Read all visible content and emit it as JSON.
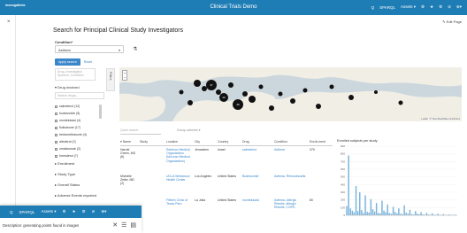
{
  "app": {
    "logo": "monogalleria",
    "title": "Clinical Trials Demo",
    "nav": [
      "Q",
      "SPARQL",
      "Assets ▾",
      "⚙",
      "★",
      "⚙",
      "⊘",
      "⊕▾"
    ]
  },
  "page": {
    "edit_label": "✎ Edit Page",
    "title": "Search for Principal Clinical Study Investigators",
    "condition_label": "Condition*",
    "condition_value": "Asthma",
    "apply": "Apply search",
    "reset": "Reset",
    "search_placeholder": "Drug, Investigator, Sponsor, Condition",
    "drug_filter": "▾  Drug involved",
    "drug_search_placeholder": "Search drugs...",
    "drugs": [
      "salmeterol (12)",
      "budesonide (5)",
      "montelukast (4)",
      "fluticasone (17)",
      "beclomethasone (4)",
      "albuterol (2)",
      "omalizumab (2)",
      "formoterol (7)"
    ],
    "enrollment": "▸  Enrollment",
    "study_type": "▸  Study Type",
    "overall_status": "▸  Overall Status",
    "adverse_events": "▸  Adverse Events reported",
    "filters_tab": "Filters"
  },
  "map": {
    "zoom_in": "+",
    "zoom_out": "−",
    "attribution": "Leaflet | © OpenStreetMap contributors"
  },
  "table": {
    "quick_search": "Quick search",
    "group_columns": "Group columns  ▾",
    "headers": [
      "▾ Name",
      "Study",
      "Location",
      "City",
      "Country",
      "Drug",
      "Condition",
      "Enroll-ment"
    ],
    "rows": [
      {
        "name": "Harold Green, MD (6)",
        "study": "",
        "location": "Rainbow Medical Organization (McLean Medical Organization)",
        "city": "Jerusalem",
        "country": "Israel",
        "drug": "salmeterol",
        "condition": "Asthma",
        "enrollment": "370"
      },
      {
        "name": "Michelle Zeller, MD (2)",
        "study": "",
        "location": "UCLA Westwood Health Center",
        "city": "Los Angeles",
        "country": "United States",
        "drug": "Budesonide",
        "condition": "Asthma, Rhinosinusitis",
        "enrollment": ""
      },
      {
        "name": "",
        "study": "",
        "location": "Fifteen Clinic of Texas Peru",
        "city": "La Jolla",
        "country": "United States",
        "drug": "montelukast",
        "condition": "Asthma, Allergic Rhinitis, Allergic Rhinitis, COPD",
        "enrollment": "80"
      }
    ]
  },
  "chart_data": {
    "type": "bar",
    "title": "Enrolled subjects per study",
    "ylim": [
      0,
      900
    ],
    "yticks": [
      "900",
      "800",
      "700",
      "600",
      "500",
      "400",
      "300",
      "200",
      "100",
      "0"
    ],
    "values": [
      120,
      780,
      90,
      60,
      40,
      380,
      55,
      300,
      70,
      30,
      260,
      45,
      35,
      210,
      80,
      50,
      160,
      30,
      25,
      190,
      60,
      40,
      140,
      30,
      20,
      110,
      45,
      25,
      90,
      20,
      15,
      130,
      35,
      20,
      70,
      15,
      10,
      55,
      20,
      12,
      40,
      10,
      8,
      30,
      10,
      6,
      25,
      8,
      5,
      20,
      6,
      4,
      15,
      5,
      3,
      10,
      4,
      2,
      8,
      3
    ]
  },
  "overlay": {
    "nav": [
      "Q",
      "SPARQL",
      "Assets ▾",
      "⚙",
      "★",
      "⚙",
      "⊘",
      "⊕▾"
    ],
    "description": "Description: generating points found in images"
  }
}
